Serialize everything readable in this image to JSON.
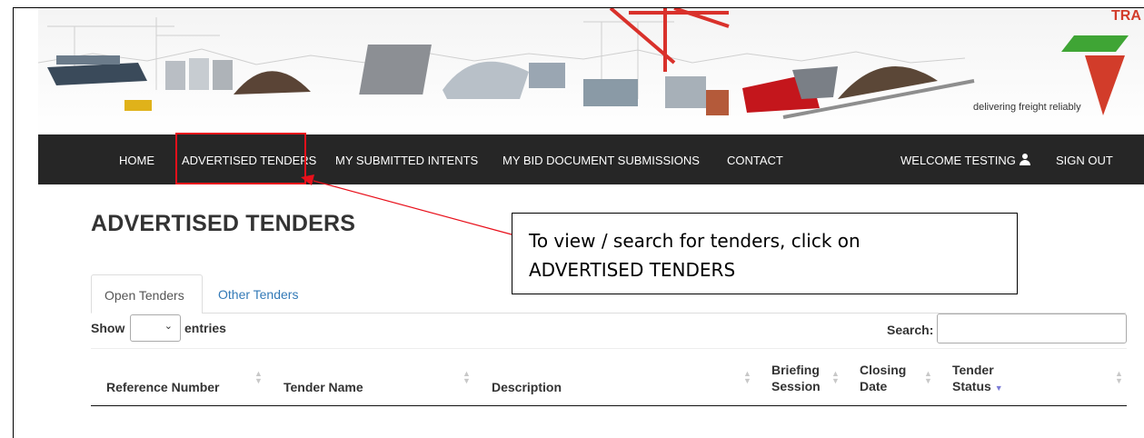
{
  "banner": {
    "tagline": "delivering freight reliably",
    "logo_text": "TRA"
  },
  "nav": {
    "home": "HOME",
    "advertised_tenders": "ADVERTISED TENDERS",
    "submitted_intents": "MY SUBMITTED INTENTS",
    "bid_submissions": "MY BID DOCUMENT SUBMISSIONS",
    "contact": "CONTACT",
    "welcome": "WELCOME TESTING",
    "sign_out": "SIGN OUT"
  },
  "annotation": {
    "line1": "To view / search for tenders, click on",
    "line2": "ADVERTISED TENDERS"
  },
  "page": {
    "title": "ADVERTISED TENDERS"
  },
  "tabs": {
    "open": "Open Tenders",
    "other": "Other Tenders"
  },
  "controls": {
    "show": "Show",
    "entries": "entries",
    "entries_value": "",
    "search_label": "Search:",
    "search_value": ""
  },
  "table": {
    "columns": [
      {
        "line1": "Reference Number",
        "line2": ""
      },
      {
        "line1": "Tender Name",
        "line2": ""
      },
      {
        "line1": "Description",
        "line2": ""
      },
      {
        "line1": "Briefing",
        "line2": "Session"
      },
      {
        "line1": "Closing",
        "line2": "Date"
      },
      {
        "line1": "Tender",
        "line2": "Status"
      }
    ]
  },
  "colors": {
    "nav_bg": "#262626",
    "highlight": "#e8101b",
    "link": "#337ab7",
    "logo_red": "#d23c2a",
    "logo_green": "#3fa535",
    "sort_active": "#7b7bd6"
  },
  "icons": [
    "user-icon",
    "chevron-down-icon",
    "sort-icon",
    "sort-desc-icon",
    "transnet-logo"
  ]
}
